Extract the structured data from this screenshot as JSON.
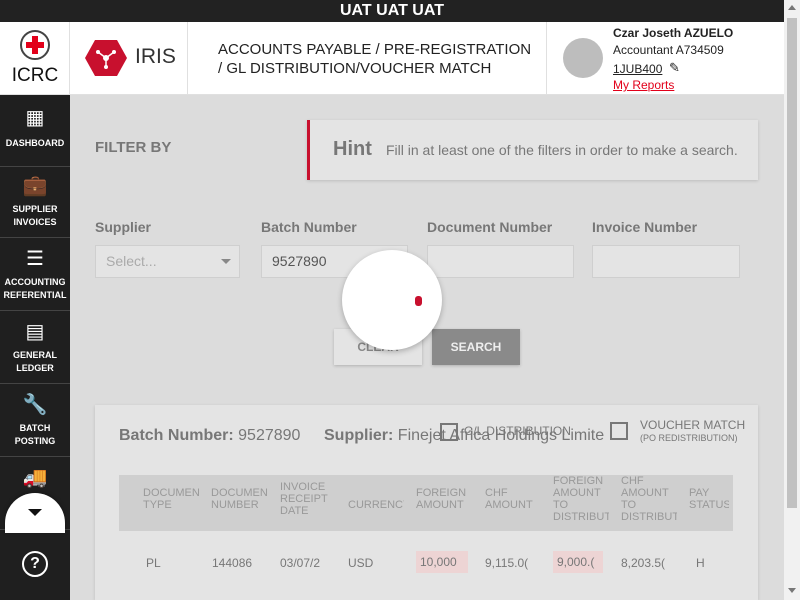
{
  "env_banner": "UAT UAT UAT",
  "org": {
    "name": "ICRC",
    "logo_icon": "red-cross-emblem-icon"
  },
  "app": {
    "name": "IRIS",
    "logo_icon": "iris-hexagon-icon",
    "brand_color": "#c8102e"
  },
  "breadcrumb": "ACCOUNTS PAYABLE / PRE-REGISTRATION / GL DISTRIBUTION/VOUCHER MATCH",
  "user": {
    "name": "Czar Joseth AZUELO",
    "role": "Accountant A734509",
    "code": "1JUB400",
    "reports_link": "My Reports"
  },
  "sidebar": {
    "items": [
      {
        "label": "DASHBOARD",
        "icon": "dashboard-icon"
      },
      {
        "label": "SUPPLIER INVOICES",
        "icon": "briefcase-icon"
      },
      {
        "label": "ACCOUNTING REFERENTIAL",
        "icon": "list-icon"
      },
      {
        "label": "GENERAL LEDGER",
        "icon": "ledger-icon"
      },
      {
        "label": "BATCH POSTING",
        "icon": "wrench-icon"
      },
      {
        "label": "",
        "icon": "truck-icon"
      }
    ],
    "help_icon": "help-icon"
  },
  "filter": {
    "title": "FILTER BY",
    "hint_title": "Hint",
    "hint_text": "Fill in at least one of the filters in order to make a search.",
    "supplier_label": "Supplier",
    "supplier_placeholder": "Select...",
    "batch_label": "Batch Number",
    "batch_value": "9527890",
    "document_label": "Document Number",
    "document_value": "",
    "invoice_label": "Invoice Number",
    "invoice_value": "",
    "clear_label": "CLEAR",
    "search_label": "SEARCH"
  },
  "results": {
    "batch_label": "Batch Number:",
    "batch_value": "9527890",
    "supplier_label": "Supplier:",
    "supplier_value": "Finejet Africa Holdings Limite",
    "gl_tab": "G/L DISTRIBUTION",
    "voucher_tab": "VOUCHER MATCH",
    "voucher_sub": "(PO REDISTRIBUTION)",
    "columns": [
      "DOCUMENT TYPE",
      "DOCUMENT NUMBER",
      "INVOICE RECEIPT DATE",
      "CURRENCY",
      "FOREIGN AMOUNT",
      "CHF AMOUNT",
      "FOREIGN AMOUNT TO DISTRIBUTE",
      "CHF AMOUNT TO DISTRIBUTE",
      "PAY STATUS"
    ],
    "row": [
      "PL",
      "144086",
      "03/07/2",
      "USD",
      "10,000",
      "9,115.0(",
      "9,000.(",
      "8,203.5(",
      "H"
    ]
  }
}
